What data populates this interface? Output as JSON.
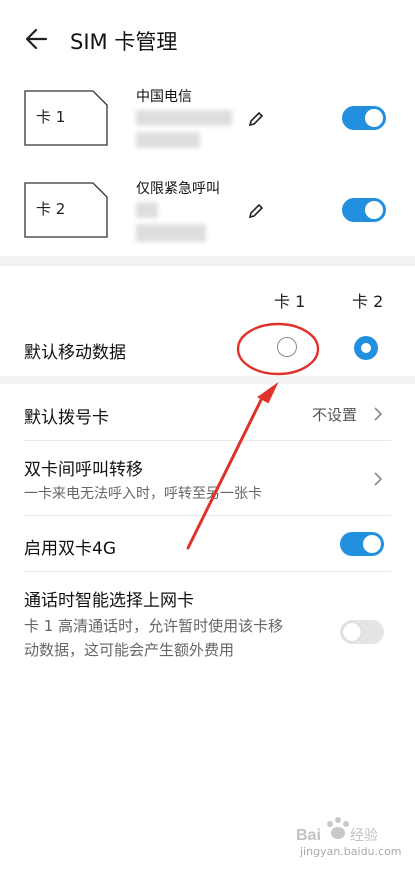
{
  "header": {
    "title": "SIM 卡管理"
  },
  "sims": [
    {
      "card_label": "卡 1",
      "carrier": "中国电信",
      "enabled": true
    },
    {
      "card_label": "卡 2",
      "carrier": "仅限紧急呼叫",
      "enabled": true
    }
  ],
  "data_section": {
    "col1": "卡 1",
    "col2": "卡 2",
    "default_data_label": "默认移动数据",
    "selected": "卡 2"
  },
  "settings": {
    "default_dial": {
      "label": "默认拨号卡",
      "value": "不设置"
    },
    "call_forward": {
      "label": "双卡间呼叫转移",
      "sub": "一卡来电无法呼入时，呼转至另一张卡"
    },
    "dual_4g": {
      "label": "启用双卡4G",
      "enabled": true
    },
    "smart_data": {
      "label": "通话时智能选择上网卡",
      "sub": "卡 1 高清通话时，允许暂时使用该卡移动数据，这可能会产生额外费用",
      "enabled": false
    }
  },
  "watermark": {
    "text": "jingyan.baidu.com"
  },
  "colors": {
    "accent": "#2390df",
    "annotation": "#e0322b"
  }
}
